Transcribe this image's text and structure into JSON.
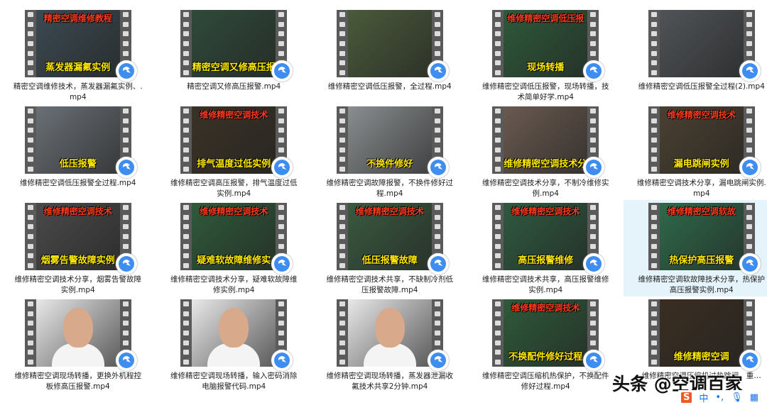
{
  "files": [
    {
      "name": "精密空调维修技术，蒸发器漏氟实例、.mp4",
      "top": "精密空调维修教程",
      "bottom": "蒸发器漏氟实例",
      "bg": "#3b4a52"
    },
    {
      "name": "精密空调又修高压报警.mp4",
      "top": "",
      "bottom": "精密空调又修高压报",
      "bg": "#2f4a3a"
    },
    {
      "name": "维修精密空调低压报警，全过程.mp4",
      "top": "",
      "bottom": "",
      "bg": "#4a5a3a"
    },
    {
      "name": "维修精密空调低压报警，现场转播，技术简单好学.mp4",
      "top": "维修精密空调低压报",
      "bottom": "现场转播",
      "bg": "#2e5a3a"
    },
    {
      "name": "维修精密空调低压报警全过程(2).mp4",
      "top": "",
      "bottom": "",
      "bg": "#505458"
    },
    {
      "name": "维修精密空调低压报警全过程.mp4",
      "top": "",
      "bottom": "低压报警",
      "bg": "#6a7076"
    },
    {
      "name": "维修精密空调高压报警，排气温度过低实例.mp4",
      "top": "维修精密空调技术",
      "bottom": "排气温度过低实例",
      "bg": "#3a3226"
    },
    {
      "name": "维修精密空调故障报警，不换件修好过程.mp4",
      "top": "",
      "bottom": "不换件修好",
      "bg": "#8a8e90"
    },
    {
      "name": "维修精密空调技术分享，不制冷维修实例.mp4",
      "top": "",
      "bottom": "维修精密空调技术分享",
      "bg": "#6a5a50"
    },
    {
      "name": "维修精密空调技术分享，漏电跳闸实例.mp4",
      "top": "维修精密空调技术",
      "bottom": "漏电跳闸实例",
      "bg": "#4a4030"
    },
    {
      "name": "维修精密空调技术分享，烟雾告警故障实例.mp4",
      "top": "维修精密空调技术",
      "bottom": "烟雾告警故障实例",
      "bg": "#4a4a4a"
    },
    {
      "name": "维修精密空调技术分享，疑难软故障维修实例.mp4",
      "top": "维修精密空调技术",
      "bottom": "疑难软故障维修实",
      "bg": "#2f5a3a"
    },
    {
      "name": "维修精密空调技术共享，不缺制冷剂低压报警故障.mp4",
      "top": "维修精密空调技术",
      "bottom": "低压报警故障",
      "bg": "#3a5a40"
    },
    {
      "name": "维修精密空调技术共享，高压报警维修实例.mp4",
      "top": "维修精密空调技术",
      "bottom": "高压报警维修",
      "bg": "#2f5a40"
    },
    {
      "name": "维修精密空调软故障技术分享，热保护高压报警实例.mp4",
      "top": "维修精密空调软故",
      "bottom": "热保护高压报警",
      "bg": "#2e6a4a"
    },
    {
      "name": "维修精密空调现场转播，更换外机程控板修高压报警.mp4",
      "top": "",
      "bottom": "",
      "bg": "#e8e8e8",
      "face": true
    },
    {
      "name": "维修精密空调现场转播，输入密码消除电脑报警代码.mp4",
      "top": "",
      "bottom": "",
      "bg": "#e8e8e8",
      "face": true
    },
    {
      "name": "维修精密空调现场转播，蒸发器泄漏收氟技术共享2分钟.mp4",
      "top": "",
      "bottom": "",
      "bg": "#e8e8e8",
      "face": true
    },
    {
      "name": "维修精密空调压缩机热保护，不换配件修好过程.mp4",
      "top": "维修精密空调技术",
      "bottom": "不换配件修好过程",
      "bg": "#2f5a3a"
    },
    {
      "name": "维修精密空调压缩机过热跳闸，重…",
      "top": "",
      "bottom": "维修精密空调",
      "bg": "#3a2e22"
    }
  ],
  "selected_index": 14,
  "watermark": "头条 @空调百家",
  "ime": {
    "logo": "S",
    "mode": "中",
    "punct": "•,",
    "mic": "🎙",
    "grid": "▦"
  }
}
